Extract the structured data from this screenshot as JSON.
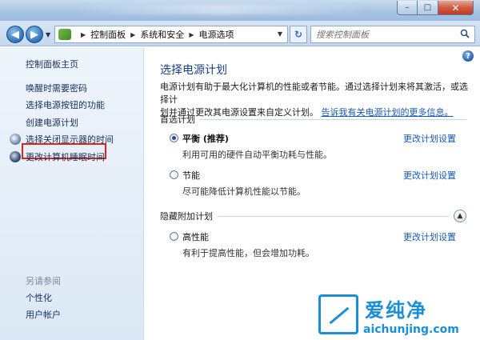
{
  "window": {
    "minimize_glyph": "–",
    "maximize_glyph": "□",
    "close_glyph": "✕"
  },
  "nav": {
    "back_glyph": "◀",
    "forward_glyph": "▶",
    "breadcrumb": [
      "控制面板",
      "系统和安全",
      "电源选项"
    ],
    "refresh_glyph": "↻",
    "search_placeholder": "搜索控制面板"
  },
  "sidebar": {
    "home": "控制面板主页",
    "items": [
      "唤醒时需要密码",
      "选择电源按钮的功能",
      "创建电源计划",
      "选择关闭显示器的时间",
      "更改计算机睡眠时间"
    ],
    "see_also_title": "另请参阅",
    "see_also": [
      "个性化",
      "用户帐户"
    ]
  },
  "main": {
    "title": "选择电源计划",
    "desc_line1": "电源计划有助于最大化计算机的性能或者节能。通过选择计划来将其激活，或选择计",
    "desc_line2": "划并通过更改其电源设置来自定义计划。",
    "desc_link": "告诉我有关电源计划的更多信息。",
    "preferred_header": "首选计划",
    "hidden_header": "隐藏附加计划",
    "plans": [
      {
        "name": "平衡 (推荐)",
        "desc": "利用可用的硬件自动平衡功耗与性能。",
        "link": "更改计划设置",
        "selected": true
      },
      {
        "name": "节能",
        "desc": "尽可能降低计算机性能以节能。",
        "link": "更改计划设置",
        "selected": false
      },
      {
        "name": "高性能",
        "desc": "有利于提高性能，但会增加功耗。",
        "link": "更改计划设置",
        "selected": false
      }
    ]
  },
  "watermark": {
    "title": "爱纯净",
    "url": "aichunjing.com"
  },
  "colors": {
    "accent": "#1659b3",
    "highlight_box": "#e0231b",
    "watermark": "#1a8ed6"
  }
}
